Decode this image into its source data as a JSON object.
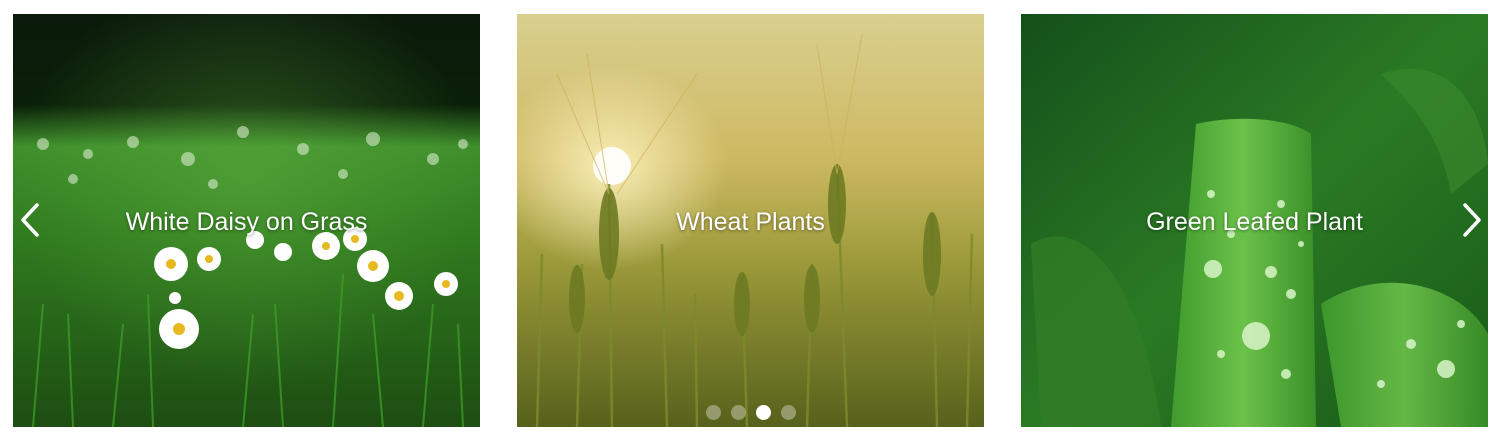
{
  "carousel": {
    "slides": [
      {
        "caption": "White Daisy on Grass",
        "image": "daisy-grass"
      },
      {
        "caption": "Wheat Plants",
        "image": "wheat-field"
      },
      {
        "caption": "Green Leafed Plant",
        "image": "wet-green-leaf"
      }
    ],
    "prev_icon": "chevron-left-icon",
    "next_icon": "chevron-right-icon",
    "indicators": {
      "count": 4,
      "active_index": 2
    }
  }
}
